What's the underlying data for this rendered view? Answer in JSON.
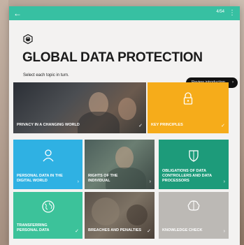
{
  "header": {
    "pager": "4/54"
  },
  "page": {
    "title": "GLOBAL DATA PROTECTION",
    "subtitle": "Select each topic in turn.",
    "review_label": "Review introduction"
  },
  "tiles": [
    {
      "label": "PRIVACY IN A CHANGING WORLD",
      "icon": "photo",
      "color": "#3a3b3d",
      "completed": true
    },
    {
      "label": "KEY PRINCIPLES",
      "icon": "padlock-icon",
      "color": "#f6ac1a",
      "completed": true
    },
    {
      "label": "PERSONAL DATA IN THE DIGITAL WORLD",
      "icon": "person-icon",
      "color": "#2fb1e3",
      "completed": false
    },
    {
      "label": "RIGHTS OF THE INDIVIDUAL",
      "icon": "photo",
      "color": "#5b6d67",
      "completed": false
    },
    {
      "label": "OBLIGATIONS OF DATA CONTROLLERS AND DATA PROCESSORS",
      "icon": "shield-icon",
      "color": "#1d9b7a",
      "completed": false
    },
    {
      "label": "TRANSFERRING PERSONAL DATA",
      "icon": "globe-icon",
      "color": "#3cc29a",
      "completed": true
    },
    {
      "label": "BREACHES AND PENALTIES",
      "icon": "photo",
      "color": "#5a5149",
      "completed": true
    },
    {
      "label": "KNOWLEDGE CHECK",
      "icon": "brain-icon",
      "color": "#bcb9b5",
      "completed": false
    }
  ],
  "glyphs": {
    "check": "✓",
    "chevron": "›",
    "back": "←",
    "menu": "⋮"
  }
}
